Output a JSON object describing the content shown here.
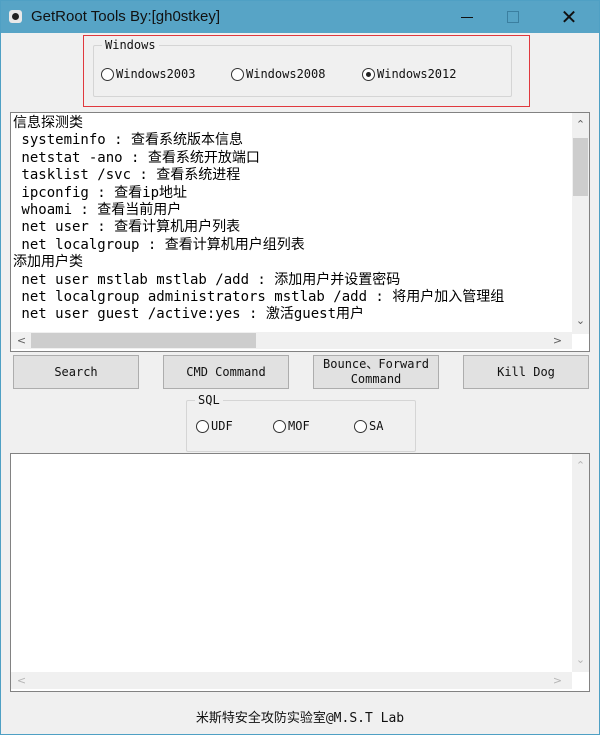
{
  "window": {
    "title": "GetRoot Tools By:[gh0stkey]",
    "icon": "app-icon",
    "controls": {
      "minimize": "minimize-icon",
      "maximize": "maximize-icon",
      "close": "✕"
    }
  },
  "os_group": {
    "legend": "Windows",
    "options": [
      {
        "label": "Windows2003",
        "selected": false
      },
      {
        "label": "Windows2008",
        "selected": false
      },
      {
        "label": "Windows2012",
        "selected": true
      }
    ],
    "highlight_color": "#e0393e"
  },
  "command_list": {
    "lines": [
      "信息探测类",
      " systeminfo : 查看系统版本信息",
      " netstat -ano : 查看系统开放端口",
      " tasklist /svc : 查看系统进程",
      " ipconfig : 查看ip地址",
      " whoami : 查看当前用户",
      " net user : 查看计算机用户列表",
      " net localgroup : 查看计算机用户组列表",
      "添加用户类",
      " net user mstlab mstlab /add : 添加用户并设置密码",
      " net localgroup administrators mstlab /add : 将用户加入管理组",
      " net user guest /active:yes : 激活guest用户"
    ]
  },
  "buttons": {
    "search": "Search",
    "cmd": "CMD Command",
    "bounce_line1": "Bounce、Forward",
    "bounce_line2": "Command",
    "kill_dog": "Kill Dog"
  },
  "sql_group": {
    "legend": "SQL",
    "options": [
      {
        "label": "UDF",
        "selected": false
      },
      {
        "label": "MOF",
        "selected": false
      },
      {
        "label": "SA",
        "selected": false
      }
    ]
  },
  "output": {
    "value": ""
  },
  "scroll": {
    "up": "⌃",
    "down": "⌄",
    "left": "<",
    "right": ">"
  },
  "footer": {
    "text": "米斯特安全攻防实验室@M.S.T Lab"
  }
}
